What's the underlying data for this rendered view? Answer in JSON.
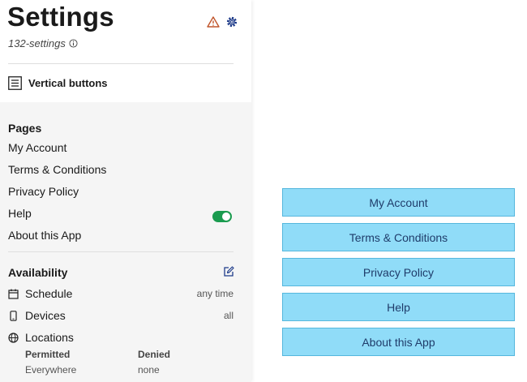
{
  "header": {
    "title": "Settings",
    "subtitle": "132-settings",
    "icons": [
      "warning-icon",
      "gear-icon"
    ]
  },
  "layout_option": {
    "label": "Vertical buttons",
    "icon": "list-icon"
  },
  "pages": {
    "title": "Pages",
    "items": [
      {
        "label": "My Account"
      },
      {
        "label": "Terms & Conditions"
      },
      {
        "label": "Privacy Policy"
      },
      {
        "label": "Help",
        "toggle_on": true
      },
      {
        "label": "About this App"
      }
    ]
  },
  "availability": {
    "title": "Availability",
    "schedule": {
      "label": "Schedule",
      "value": "any time"
    },
    "devices": {
      "label": "Devices",
      "value": "all"
    },
    "locations": {
      "label": "Locations",
      "permitted_header": "Permitted",
      "permitted_value": "Everywhere",
      "denied_header": "Denied",
      "denied_value": "none"
    }
  },
  "preview_buttons": [
    "My Account",
    "Terms & Conditions",
    "Privacy Policy",
    "Help",
    "About this App"
  ],
  "colors": {
    "warning": "#c0552b",
    "gear": "#1f3c8a",
    "toggle_on": "#1a9b4f",
    "button_bg": "#90dcf8",
    "button_border": "#56b7dd"
  }
}
